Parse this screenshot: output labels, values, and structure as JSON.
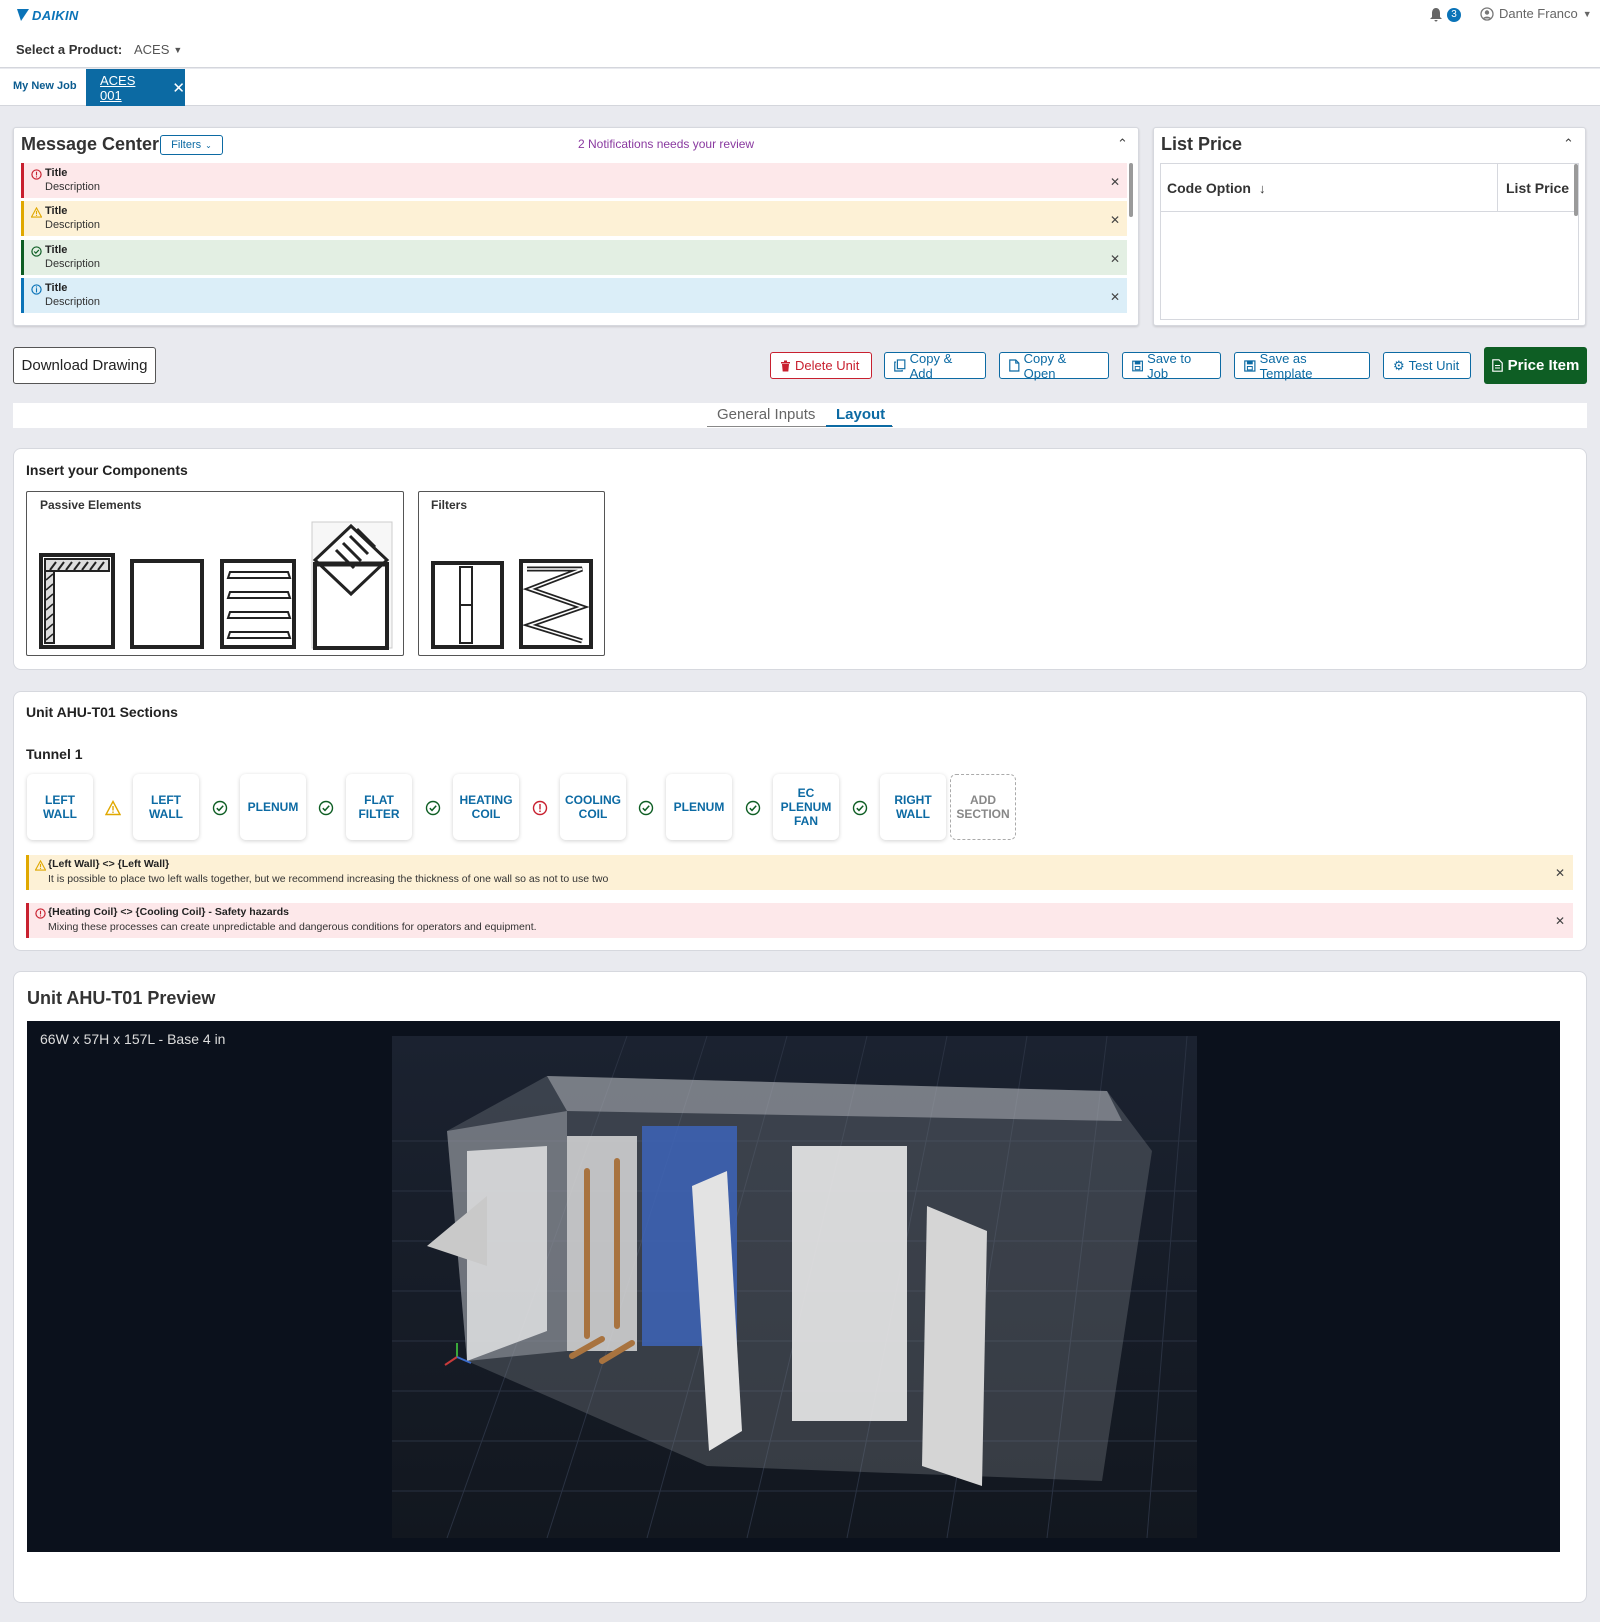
{
  "header": {
    "brand": "DAIKIN",
    "notification_count": "3",
    "user_name": "Dante Franco",
    "product_label": "Select a Product:",
    "product_value": "ACES"
  },
  "tabs": {
    "job": "My New Job",
    "active": "ACES 001"
  },
  "message_center": {
    "title": "Message Center",
    "filters_label": "Filters",
    "notice": "2 Notifications needs your review",
    "messages": [
      {
        "type": "error",
        "title": "Title",
        "description": "Description"
      },
      {
        "type": "warning",
        "title": "Title",
        "description": "Description"
      },
      {
        "type": "success",
        "title": "Title",
        "description": "Description"
      },
      {
        "type": "info",
        "title": "Title",
        "description": "Description"
      }
    ]
  },
  "list_price": {
    "title": "List Price",
    "col_code": "Code Option",
    "col_price": "List Price"
  },
  "actions": {
    "download": "Download Drawing",
    "delete": "Delete Unit",
    "copy_add": "Copy & Add",
    "copy_open": "Copy & Open",
    "save_job": "Save to Job",
    "save_template": "Save as Template",
    "test_unit": "Test Unit",
    "price_item": "Price Item"
  },
  "mode_tabs": {
    "general": "General Inputs",
    "layout": "Layout"
  },
  "components": {
    "title": "Insert your Components",
    "passive_title": "Passive Elements",
    "filters_title": "Filters"
  },
  "sections": {
    "title": "Unit AHU-T01 Sections",
    "tunnel": "Tunnel 1",
    "cards": [
      "LEFT WALL",
      "LEFT WALL",
      "PLENUM",
      "FLAT FILTER",
      "HEATING COIL",
      "COOLING COIL",
      "PLENUM",
      "EC PLENUM FAN",
      "RIGHT WALL",
      "ADD SECTION"
    ],
    "statuses": [
      "warning",
      "success",
      "success",
      "success",
      "error",
      "success",
      "success",
      "success"
    ],
    "alerts": [
      {
        "type": "warning",
        "title": "{Left Wall} <> {Left Wall}",
        "description": "It is possible to place two left walls together, but we recommend increasing the thickness of one wall so as not to use two"
      },
      {
        "type": "error",
        "title": "{Heating Coil} <> {Cooling Coil} - Safety hazards",
        "description": "Mixing these processes can create unpredictable and dangerous conditions for operators and equipment."
      }
    ]
  },
  "preview": {
    "title": "Unit AHU-T01 Preview",
    "dimensions": "66W x 57H x 157L - Base 4 in"
  },
  "colors": {
    "primary": "#0c6aa3",
    "success": "#0e5e24",
    "error": "#c8202f",
    "warning": "#e0a800",
    "info": "#0a73b8"
  }
}
